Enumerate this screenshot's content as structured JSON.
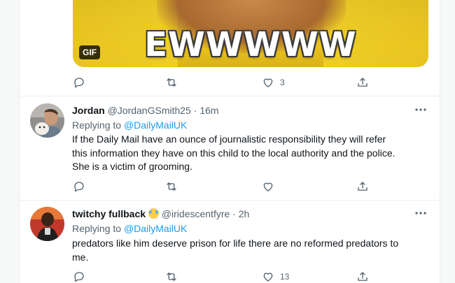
{
  "gif_tweet": {
    "caption": "EWWWWW",
    "gif_badge": "GIF",
    "actions": {
      "reply_count": "",
      "retweet_count": "",
      "like_count": "3"
    }
  },
  "tweets": [
    {
      "name": "Jordan",
      "handle": "@JordanGSmith25",
      "separator": "·",
      "time": "16m",
      "replying_prefix": "Replying to",
      "replying_to": "@DailyMailUK",
      "text_lines": [
        "If the Daily Mail have an ounce of journalistic responsibility they will refer",
        "this information they have on this child to the local authority and the police.",
        "She is a victim of grooming."
      ],
      "like_count": ""
    },
    {
      "name": "twitchy fullback",
      "emoji": "face-with-tears-of-joy",
      "handle": "@iridescentfyre",
      "separator": "·",
      "time": "2h",
      "replying_prefix": "Replying to",
      "replying_to": "@DailyMailUK",
      "text_lines": [
        "predators like him deserve prison for life there are no reformed predators to",
        "me."
      ],
      "like_count": "13"
    }
  ],
  "icons": {
    "reply": "reply-icon",
    "retweet": "retweet-icon",
    "like": "heart-icon",
    "share": "share-icon",
    "more": "more-icon"
  },
  "colors": {
    "link": "#1d9bf0",
    "secondary": "#536471",
    "text": "#0f1419",
    "divider": "#ebeef0"
  }
}
